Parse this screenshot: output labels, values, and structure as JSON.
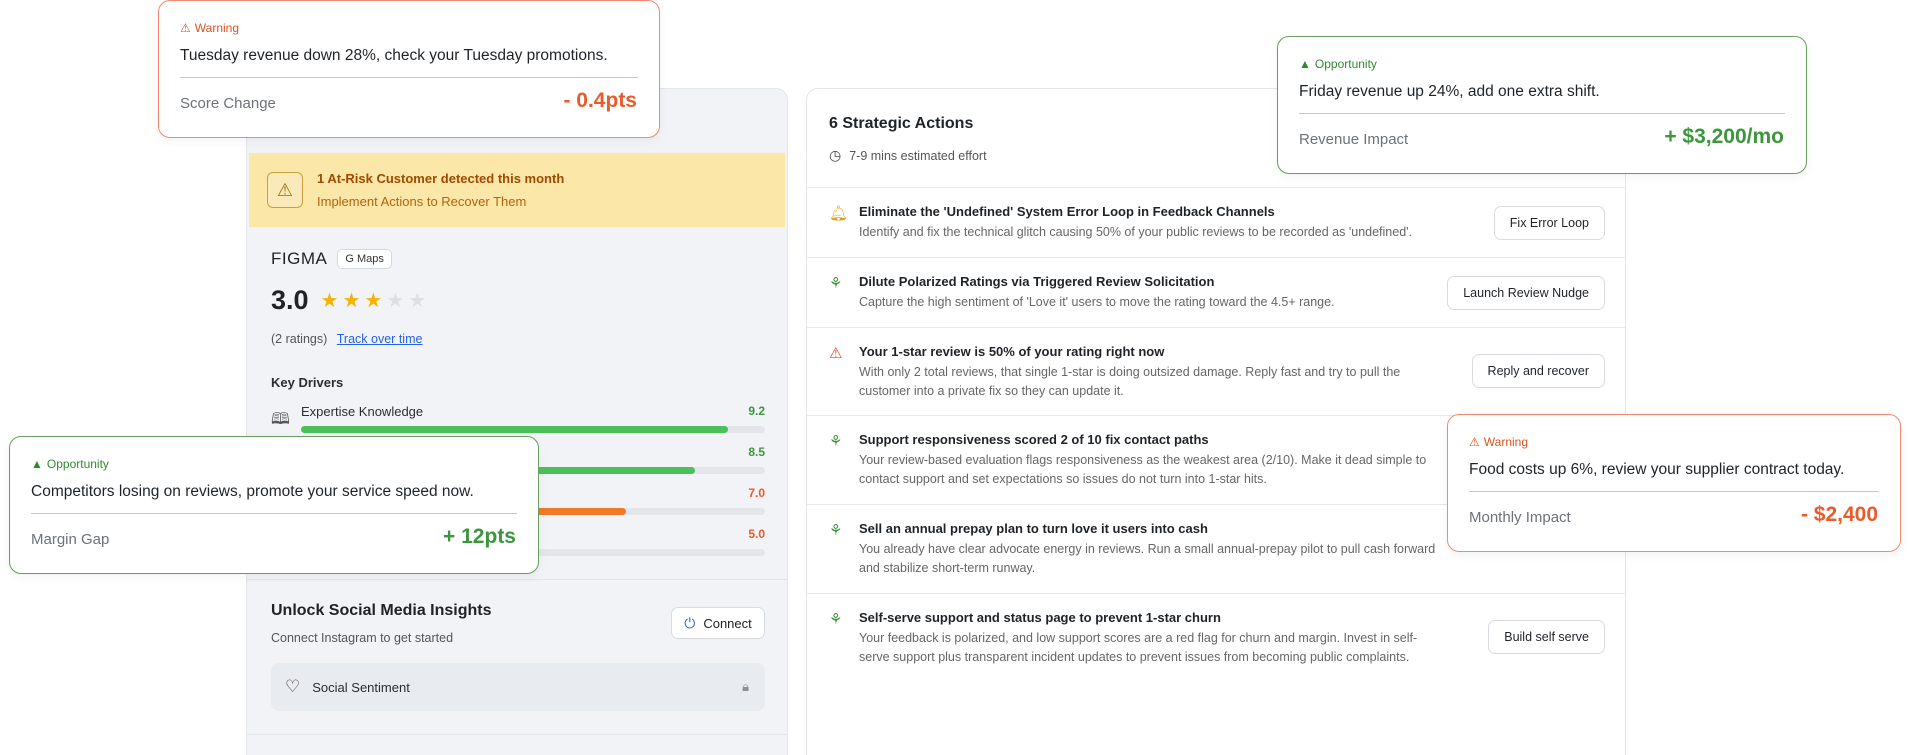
{
  "left_panel": {
    "alert": {
      "title": "1 At-Risk Customer detected this month",
      "subtitle": "Implement Actions to Recover Them",
      "icon": "warning-triangle-icon"
    },
    "business": {
      "name": "FIGMA",
      "source_badge": "G Maps"
    },
    "rating": {
      "value": "3.0",
      "stars_filled": 3,
      "stars_total": 5,
      "count_text": "(2 ratings)",
      "track_link": "Track over time"
    },
    "key_drivers": {
      "title": "Key Drivers",
      "items": [
        {
          "label": "Expertise Knowledge",
          "score": "9.2",
          "fill": 0.92,
          "color": "#4cbf5b",
          "score_color": "#3c963c",
          "icon": "book-icon"
        },
        {
          "label": "",
          "score": "8.5",
          "fill": 0.85,
          "color": "#4cbf5b",
          "score_color": "#3c963c",
          "icon": ""
        },
        {
          "label": "",
          "score": "7.0",
          "fill": 0.7,
          "color": "#ef7a28",
          "score_color": "#ea5a2a",
          "icon": ""
        },
        {
          "label": "",
          "score": "5.0",
          "fill": 0.5,
          "color": "#ef5a3a",
          "score_color": "#ea5a2a",
          "icon": ""
        }
      ]
    },
    "social": {
      "title": "Unlock Social Media Insights",
      "subtitle": "Connect Instagram to get started",
      "connect_label": "Connect",
      "sentiment_label": "Social Sentiment"
    }
  },
  "right_panel": {
    "title": "6 Strategic Actions",
    "effort": "7-9 mins estimated effort",
    "actions": [
      {
        "icon": "bell-icon",
        "icon_color": "#e0a21a",
        "title": "Eliminate the 'Undefined' System Error Loop in Feedback Channels",
        "desc": "Identify and fix the technical glitch causing 50% of your public reviews to be recorded as 'undefined'.",
        "button": "Fix Error Loop"
      },
      {
        "icon": "sprout-icon",
        "icon_color": "#3c963c",
        "title": "Dilute Polarized Ratings via Triggered Review Solicitation",
        "desc": "Capture the high sentiment of 'Love it' users to move the rating toward the 4.5+ range.",
        "button": "Launch Review Nudge"
      },
      {
        "icon": "warning-triangle-icon",
        "icon_color": "#e0452a",
        "title": "Your 1-star review is 50% of your rating right now",
        "desc": "With only 2 total reviews, that single 1-star is doing outsized damage. Reply fast and try to pull the customer into a private fix so they can update it.",
        "button": "Reply and recover"
      },
      {
        "icon": "sprout-icon",
        "icon_color": "#3c963c",
        "title": "Support responsiveness scored 2 of 10 fix contact paths",
        "desc": "Your review-based evaluation flags responsiveness as the weakest area (2/10). Make it dead simple to contact support and set expectations so issues do not turn into 1-star hits.",
        "button": ""
      },
      {
        "icon": "sprout-icon",
        "icon_color": "#3c963c",
        "title": "Sell an annual prepay plan to turn love it users into cash",
        "desc": "You already have clear advocate energy in reviews. Run a small annual-prepay pilot to pull cash forward and stabilize short-term runway.",
        "button": ""
      },
      {
        "icon": "sprout-icon",
        "icon_color": "#3c963c",
        "title": "Self-serve support and status page to prevent 1-star churn",
        "desc": "Your feedback is polarized, and low support scores are a red flag for churn and margin. Invest in self-serve support plus transparent incident updates to prevent issues from becoming public complaints.",
        "button": "Build self serve"
      }
    ]
  },
  "cards": {
    "warning_tuesday": {
      "tag": "Warning",
      "message": "Tuesday revenue down 28%, check your Tuesday promotions.",
      "metric_label": "Score Change",
      "metric_value": "- 0.4pts"
    },
    "opportunity_friday": {
      "tag": "Opportunity",
      "message": "Friday revenue up 24%, add one extra shift.",
      "metric_label": "Revenue Impact",
      "metric_value": "+ $3,200/mo"
    },
    "opportunity_competitors": {
      "tag": "Opportunity",
      "message": "Competitors losing on reviews, promote your service speed now.",
      "metric_label": "Margin Gap",
      "metric_value": "+ 12pts"
    },
    "warning_food": {
      "tag": "Warning",
      "message": "Food costs up 6%, review your supplier contract today.",
      "metric_label": "Monthly Impact",
      "metric_value": "- $2,400"
    }
  },
  "colors": {
    "warning": "#ea5a2a",
    "opportunity": "#3c963c",
    "alert_bg": "#fbe7a8"
  }
}
